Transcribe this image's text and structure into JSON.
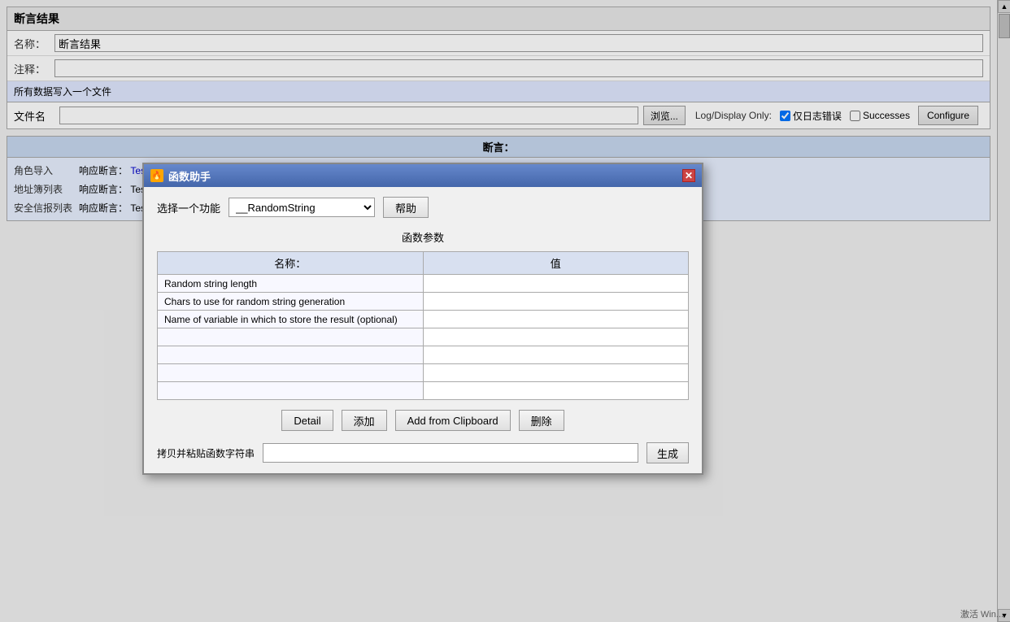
{
  "page": {
    "title": "断言结果"
  },
  "assertion_panel": {
    "title": "断言结果",
    "name_label": "名称：",
    "name_value": "断言结果",
    "comment_label": "注释：",
    "comment_value": "",
    "file_section_label": "所有数据写入一个文件",
    "file_label": "文件名",
    "file_value": "",
    "browse_btn": "浏览...",
    "log_display_label": "Log/Display Only:",
    "log_errors_label": "仅日志错误",
    "log_errors_checked": true,
    "successes_label": "Successes",
    "successes_checked": false,
    "configure_btn": "Configure"
  },
  "assertions_section": {
    "title": "断言：",
    "items": [
      {
        "name": "角色导入",
        "response_label": "响应断言：",
        "response_text": "Test failed: text expected not to contain /不正确/"
      },
      {
        "name": "地址簿列表",
        "response_label": "响应断言：",
        "response_text": "Tes"
      },
      {
        "name": "安全信报列表",
        "response_label": "响应断言：",
        "response_text": "Tes"
      }
    ]
  },
  "dialog": {
    "title": "函数助手",
    "icon": "🔥",
    "close_btn": "✕",
    "select_function_label": "选择一个功能",
    "selected_function": "__RandomString",
    "help_btn": "帮助",
    "params_title": "函数参数",
    "params_name_col": "名称：",
    "params_value_col": "值",
    "params": [
      {
        "name": "Random string length",
        "value": ""
      },
      {
        "name": "Chars to use for random string generation",
        "value": ""
      },
      {
        "name": "Name of variable in which to store the result (optional)",
        "value": ""
      }
    ],
    "buttons": {
      "detail": "Detail",
      "add": "添加",
      "add_from_clipboard": "Add from Clipboard",
      "delete": "删除"
    },
    "generate_label": "拷贝并粘贴函数字符串",
    "generate_input_value": "",
    "generate_btn": "生成"
  },
  "scrollbar": {
    "up_arrow": "▲",
    "down_arrow": "▼"
  }
}
